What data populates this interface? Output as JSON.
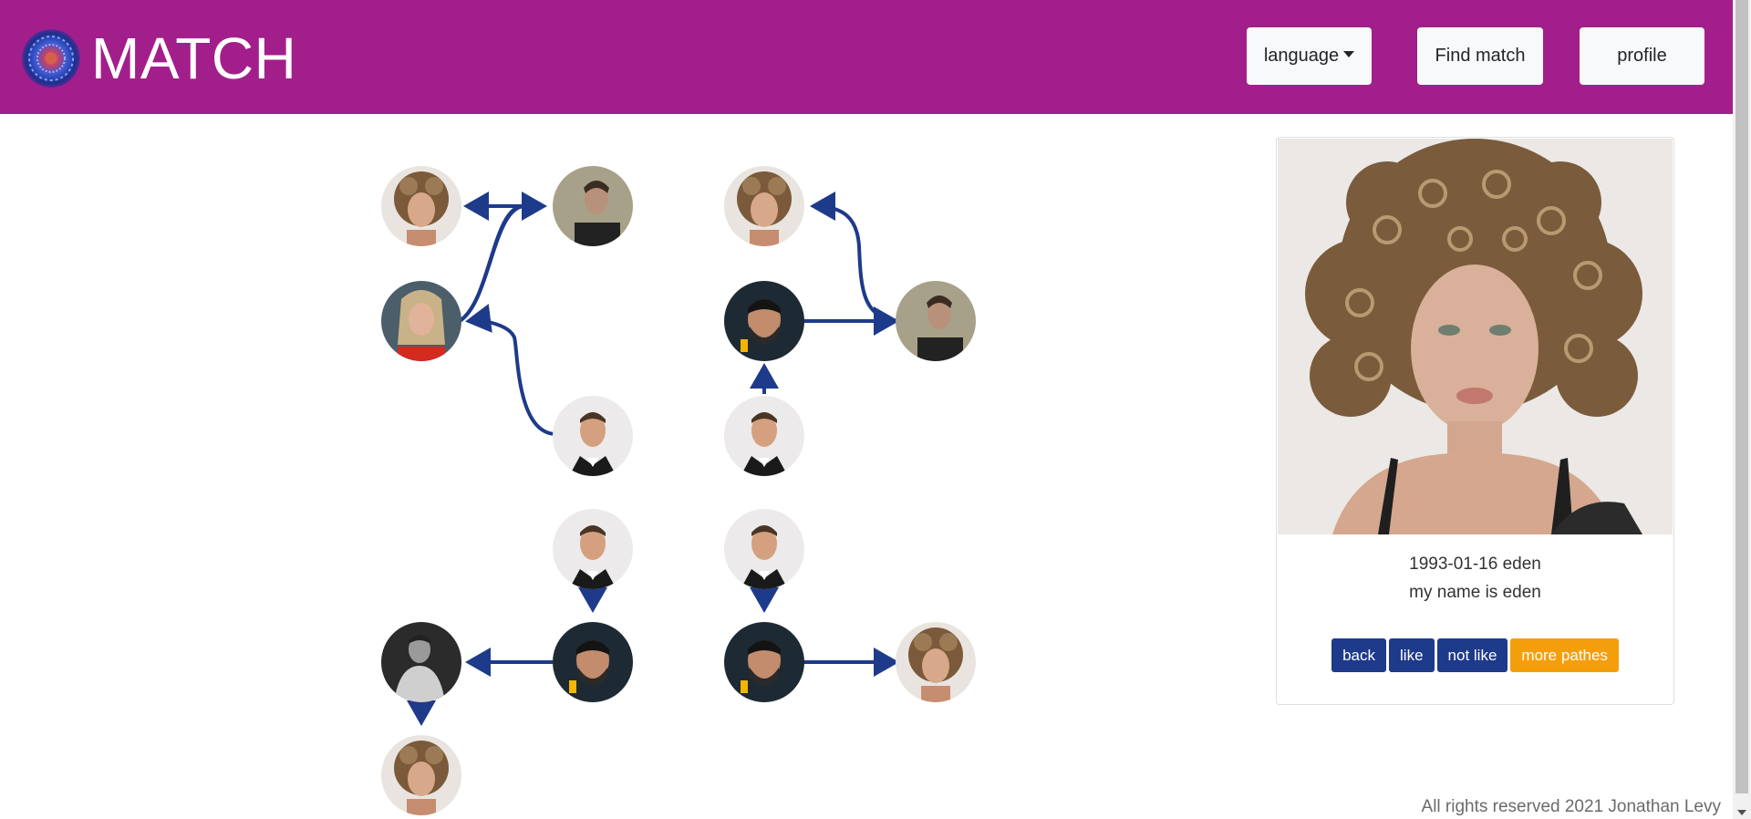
{
  "navbar": {
    "brand": "MATCH",
    "background": "#a21f8b",
    "language_label": "language",
    "find_match_label": "Find match",
    "profile_label": "profile"
  },
  "graph": {
    "arrow_color": "#1e3a8a",
    "nodes": [
      {
        "id": "n1",
        "icon": "curly-hair-woman-avatar"
      },
      {
        "id": "n2",
        "icon": "man-beige-background-avatar"
      },
      {
        "id": "n3",
        "icon": "blonde-woman-red-top-avatar"
      },
      {
        "id": "n4",
        "icon": "man-suit-avatar"
      },
      {
        "id": "n5",
        "icon": "curly-hair-woman-avatar"
      },
      {
        "id": "n6",
        "icon": "bearded-man-avatar"
      },
      {
        "id": "n7",
        "icon": "man-beige-background-avatar"
      },
      {
        "id": "n8",
        "icon": "man-suit-avatar"
      },
      {
        "id": "n9",
        "icon": "man-suit-avatar"
      },
      {
        "id": "n10",
        "icon": "man-suit-avatar"
      },
      {
        "id": "n11",
        "icon": "bw-man-avatar"
      },
      {
        "id": "n12",
        "icon": "bearded-man-avatar"
      },
      {
        "id": "n13",
        "icon": "bearded-man-avatar"
      },
      {
        "id": "n14",
        "icon": "curly-hair-woman-avatar"
      },
      {
        "id": "n15",
        "icon": "curly-hair-woman-avatar"
      }
    ]
  },
  "profile_card": {
    "image_icon": "curly-hair-woman-photo",
    "birth_and_name": "1993-01-16 eden",
    "bio": "my name is eden",
    "buttons": {
      "back": "back",
      "like": "like",
      "not_like": "not like",
      "more_paths": "more pathes"
    },
    "primary_color": "#1e3a8a",
    "warning_color": "#f59e0b"
  },
  "footer": {
    "text": "All rights reserved 2021 Jonathan Levy"
  }
}
